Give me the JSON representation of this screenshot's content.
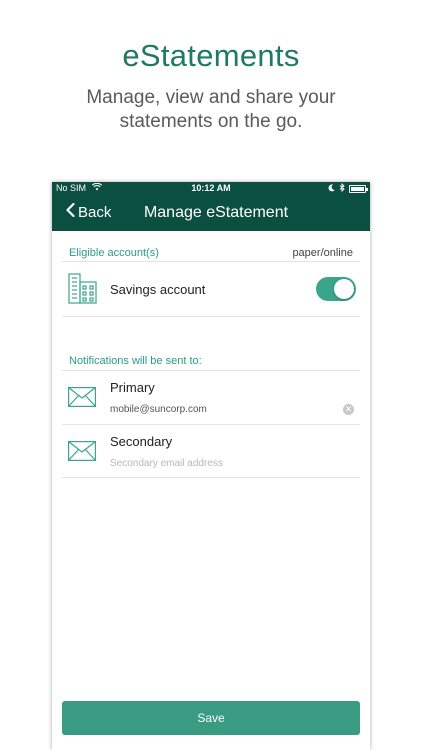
{
  "promo": {
    "title": "eStatements",
    "subtitle": "Manage, view and share your statements on the go."
  },
  "status_bar": {
    "carrier": "No SIM",
    "time": "10:12 AM"
  },
  "nav": {
    "back_label": "Back",
    "title": "Manage eStatement"
  },
  "accounts_section": {
    "header": "Eligible account(s)",
    "header_right": "paper/online",
    "items": [
      {
        "label": "Savings account",
        "online": true
      }
    ]
  },
  "notifications_section": {
    "header": "Notifications will be sent to:",
    "primary": {
      "title": "Primary",
      "value": "mobile@suncorp.com",
      "placeholder": ""
    },
    "secondary": {
      "title": "Secondary",
      "value": "",
      "placeholder": "Secondary email address"
    }
  },
  "save_label": "Save",
  "colors": {
    "brand_dark": "#0b4f41",
    "accent": "#3aa58a",
    "promo_title": "#1f7a60"
  }
}
